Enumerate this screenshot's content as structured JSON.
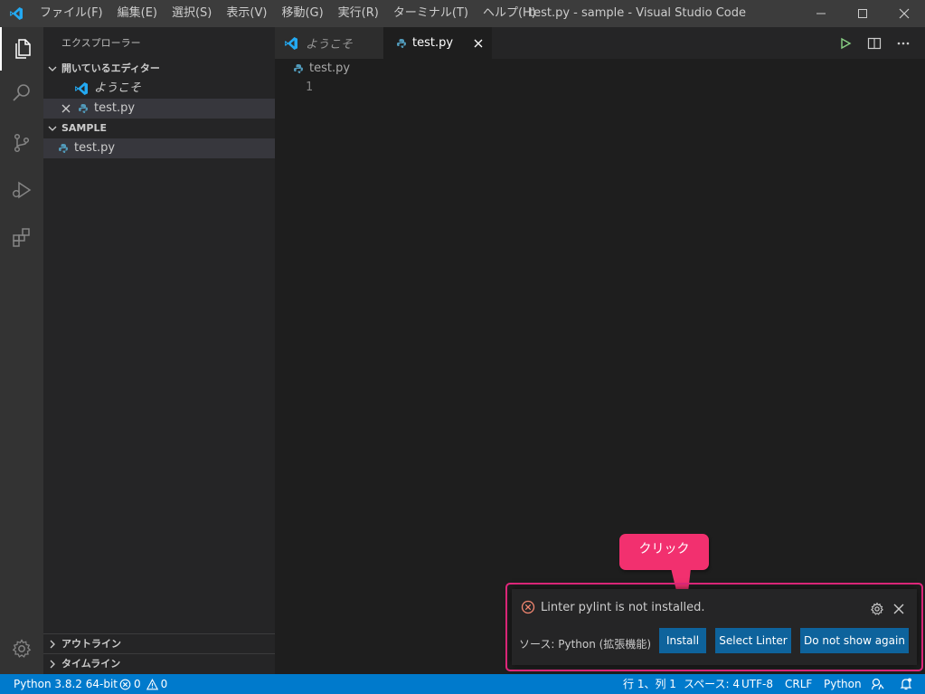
{
  "window": {
    "title": "test.py - sample - Visual Studio Code"
  },
  "menu": [
    "ファイル(F)",
    "編集(E)",
    "選択(S)",
    "表示(V)",
    "移動(G)",
    "実行(R)",
    "ターミナル(T)",
    "ヘルプ(H)"
  ],
  "sidebar": {
    "title": "エクスプローラー",
    "open_editors": {
      "header": "開いているエディター",
      "items": [
        {
          "label": "ようこそ"
        },
        {
          "label": "test.py"
        }
      ]
    },
    "folder": {
      "header": "SAMPLE",
      "items": [
        {
          "label": "test.py"
        }
      ]
    },
    "outline": "アウトライン",
    "timeline": "タイムライン"
  },
  "tabs": [
    {
      "label": "ようこそ"
    },
    {
      "label": "test.py"
    }
  ],
  "breadcrumb": "test.py",
  "editor": {
    "line_number": "1"
  },
  "notification": {
    "message": "Linter pylint is not installed.",
    "source": "ソース: Python (拡張機能)",
    "buttons": {
      "install": "Install",
      "select": "Select Linter",
      "dismiss": "Do not show again"
    }
  },
  "callout": "クリック",
  "statusbar": {
    "interpreter": "Python 3.8.2 64-bit",
    "errors": "0",
    "warnings": "0",
    "position": "行 1、列 1",
    "spaces": "スペース: 4",
    "encoding": "UTF-8",
    "eol": "CRLF",
    "language": "Python"
  },
  "colors": {
    "accent": "#007acc",
    "button": "#0e639c",
    "highlight": "#e4287d",
    "callout": "#f2306f",
    "error": "#f48771",
    "python_icon": "#519aba"
  }
}
